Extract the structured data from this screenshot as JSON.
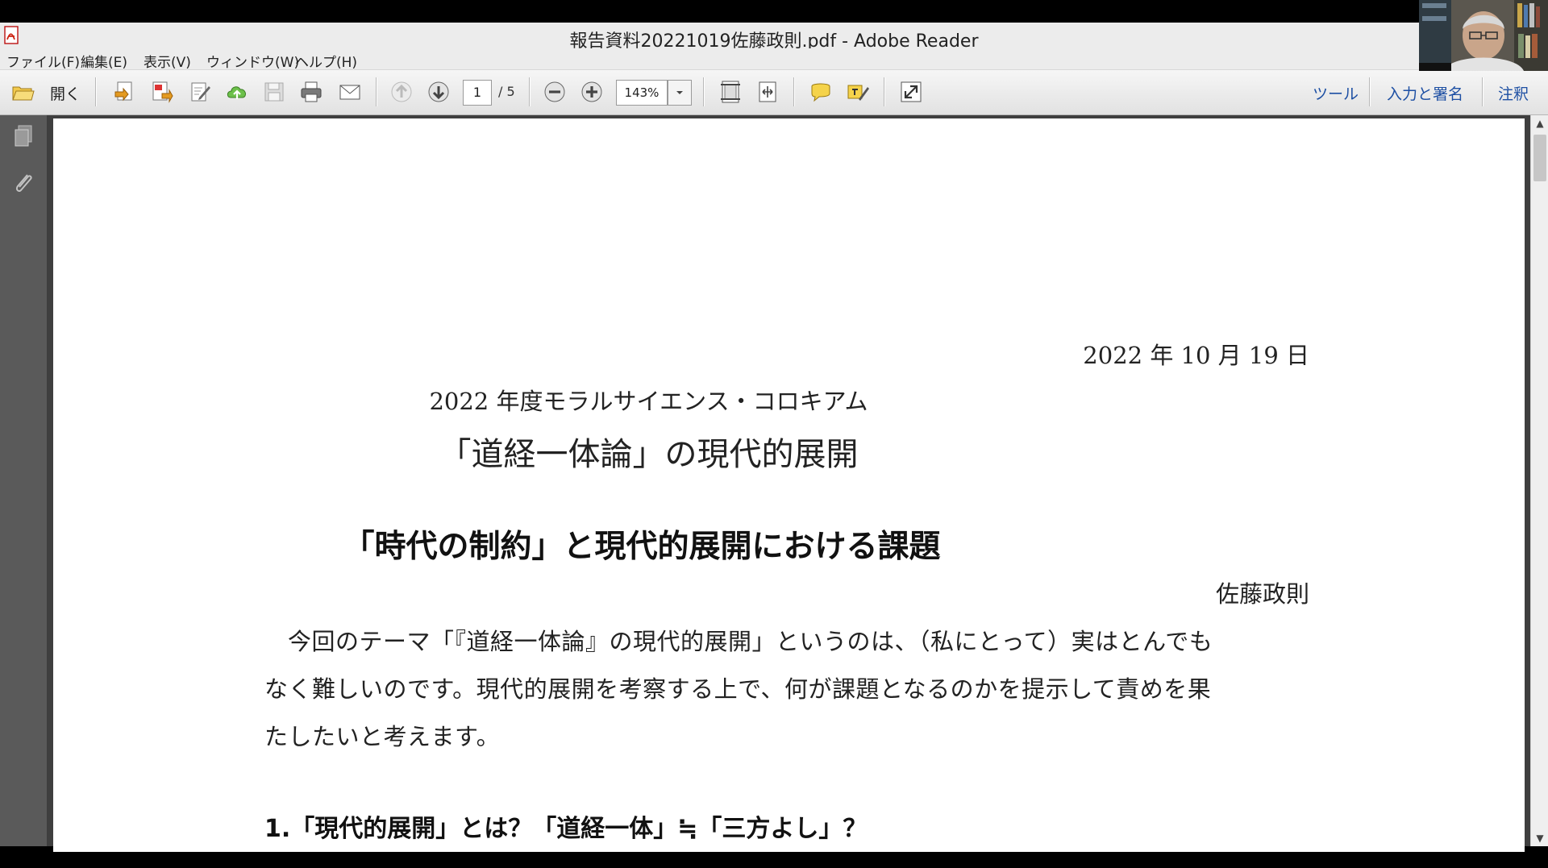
{
  "window": {
    "title": "報告資料20221019佐藤政則.pdf - Adobe Reader"
  },
  "menubar": {
    "items": [
      "ファイル(F)",
      "編集(E)",
      "表示(V)",
      "ウィンドウ(W)",
      "ヘルプ(H)"
    ]
  },
  "toolbar": {
    "open_label": "開く",
    "page_current": "1",
    "page_total": "/ 5",
    "zoom": "143%",
    "right_tabs": [
      "ツール",
      "入力と署名",
      "注釈"
    ]
  },
  "document": {
    "date": "2022 年 10 月 19 日",
    "event": "2022 年度モラルサイエンス・コロキアム",
    "theme": "「道経一体論」の現代的展開",
    "heading": "「時代の制約」と現代的展開における課題",
    "author": "佐藤政則",
    "paragraph_lines": [
      "今回のテーマ「『道経一体論』の現代的展開」というのは、（私にとって）実はとんでも",
      "なく難しいのです。現代的展開を考察する上で、何が課題となるのかを提示して責めを果",
      "たしたいと考えます。"
    ],
    "section1": "1.「現代的展開」とは？「道経一体」≒「三方よし」？"
  },
  "colors": {
    "accent": "#1d4fa3",
    "nav_panel": "#5a5a5a",
    "doc_background": "#3f3f3f"
  },
  "icons": [
    "adobe-reader-icon",
    "open-folder-icon",
    "create-pdf-icon",
    "export-pdf-icon",
    "edit-icon",
    "upload-cloud-icon",
    "save-icon",
    "print-icon",
    "email-icon",
    "previous-page-icon",
    "next-page-icon",
    "zoom-out-icon",
    "zoom-in-icon",
    "fit-page-icon",
    "fit-width-icon",
    "comment-icon",
    "highlight-icon",
    "full-screen-icon",
    "pages-panel-icon",
    "attachments-icon"
  ]
}
